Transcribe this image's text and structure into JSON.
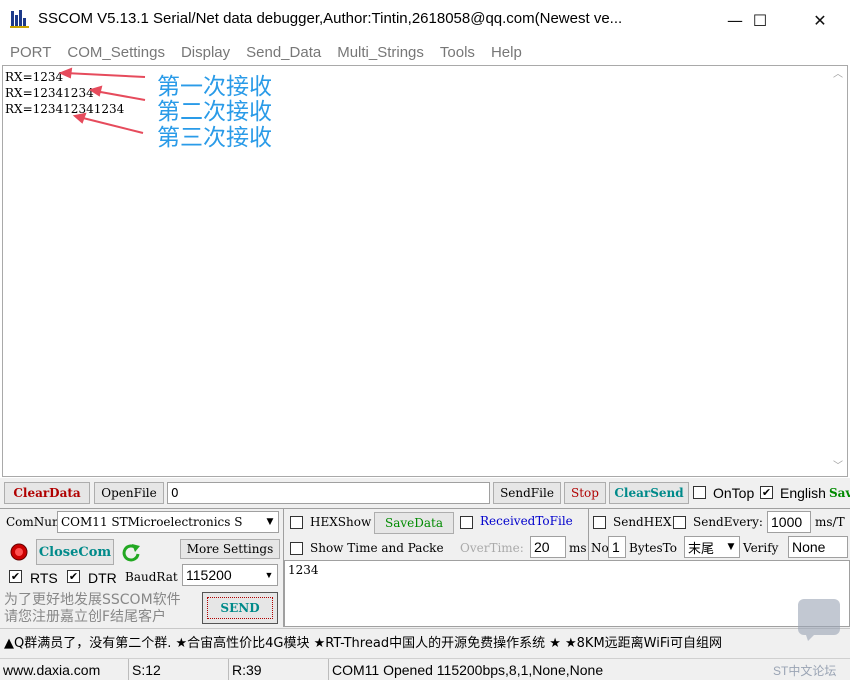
{
  "window": {
    "title": "SSCOM V5.13.1 Serial/Net data debugger,Author:Tintin,2618058@qq.com(Newest ve...",
    "minimize": "—",
    "maximize": "☐",
    "close": "✕"
  },
  "menu": [
    "PORT",
    "COM_Settings",
    "Display",
    "Send_Data",
    "Multi_Strings",
    "Tools",
    "Help"
  ],
  "receive": {
    "lines": [
      "RX=1234",
      "RX=12341234",
      "RX=123412341234"
    ],
    "annotations": [
      "第一次接收",
      "第二次接收",
      "第三次接收"
    ],
    "annotation_color": "#2a9be8",
    "arrow_color": "#e64b5c"
  },
  "row1": {
    "clear_data": "ClearData",
    "open_file": "OpenFile",
    "file_path": "0",
    "send_file": "SendFile",
    "stop": "Stop",
    "clear_send": "ClearSend",
    "ontop_label": "OnTop",
    "ontop_checked": false,
    "english_label": "English",
    "english_checked": true,
    "save_label": "Sav"
  },
  "port": {
    "comnum_label": "ComNum",
    "comnum_value": "COM11 STMicroelectronics S",
    "close_com": "CloseCom",
    "more_settings": "More Settings",
    "rts_label": "RTS",
    "rts_checked": true,
    "dtr_label": "DTR",
    "dtr_checked": true,
    "baud_label": "BaudRat",
    "baud_value": "115200"
  },
  "options": {
    "hexshow": "HEXShow",
    "save_data": "SaveData",
    "received_to_file": "ReceivedToFile",
    "sendhex": "SendHEX",
    "send_every": "SendEvery:",
    "send_every_value": "1000",
    "send_every_unit": "ms/T",
    "show_time": "Show Time and Packe",
    "overtime_label": "OverTime:",
    "overtime_value": "20",
    "ms_label": "ms",
    "no_label": "No",
    "bytes_value": "1",
    "bytesto_label": "BytesTo",
    "tail_value": "末尾",
    "verify_label": "Verify",
    "verify_value": "None"
  },
  "send": {
    "text": "1234",
    "send_button": "SEND",
    "promo": "为了更好地发展SSCOM软件\n请您注册嘉立创F结尾客户"
  },
  "ticker": "▲Q群满员了，没有第二个群.  ★合宙高性价比4G模块  ★RT-Thread中国人的开源免费操作系统  ★  ★8KM远距离WiFi可自组网",
  "status": {
    "website": "www.daxia.com",
    "sent": "S:12",
    "received": "R:39",
    "port_state": "COM11 Opened  115200bps,8,1,None,None",
    "watermark": "ST中文论坛"
  }
}
